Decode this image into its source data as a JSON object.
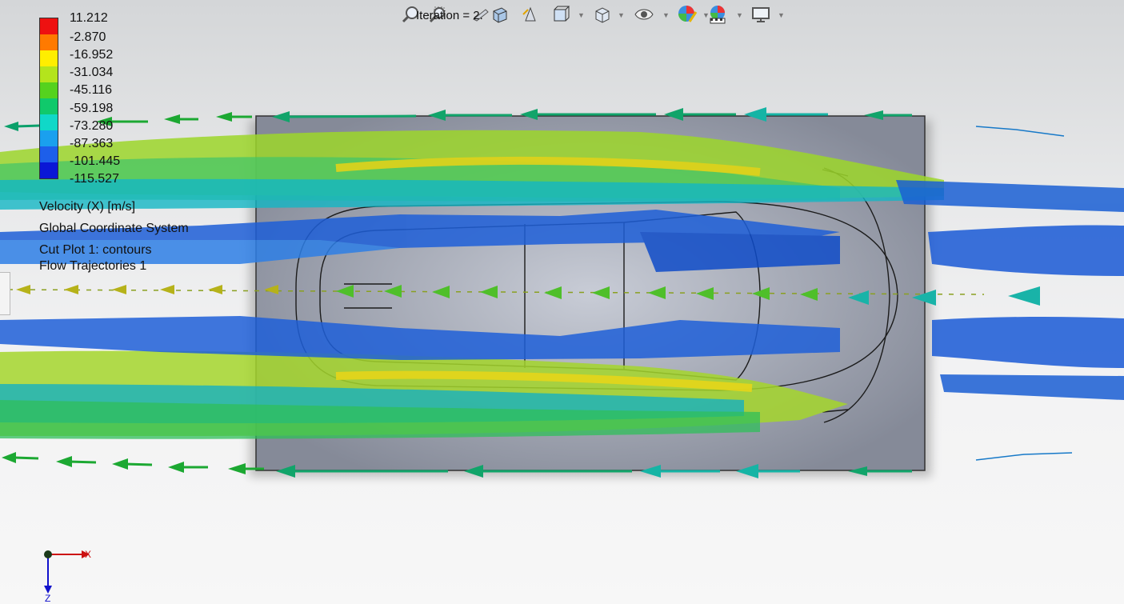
{
  "toolbar": {
    "iteration_label": "Iteration = 2.",
    "buttons": [
      {
        "name": "zoom-to-fit-icon"
      },
      {
        "name": "zoom-to-area-icon"
      },
      {
        "name": "previous-view-icon"
      },
      {
        "name": "section-view-icon"
      },
      {
        "name": "view-orientation-icon"
      },
      {
        "name": "display-style-icon"
      },
      {
        "name": "hide-show-items-icon"
      },
      {
        "name": "edit-appearance-icon"
      },
      {
        "name": "apply-scene-icon"
      },
      {
        "name": "view-settings-icon"
      }
    ]
  },
  "legend": {
    "values": [
      "11.212",
      "-2.870",
      "-16.952",
      "-31.034",
      "-45.116",
      "-59.198",
      "-73.280",
      "-87.363",
      "-101.445",
      "-115.527"
    ],
    "colors": [
      "#ee1111",
      "#ff7a00",
      "#ffee00",
      "#b4e41c",
      "#55d21e",
      "#10c96b",
      "#10d8c8",
      "#1aa0ee",
      "#1d5fea",
      "#0a17d6"
    ],
    "quantity": "Velocity (X) [m/s]",
    "coordinate_system": "Global Coordinate System",
    "cut_plot": "Cut Plot 1: contours",
    "flow_trajectories": "Flow Trajectories 1"
  },
  "triad": {
    "x_label": "X",
    "z_label": "Z"
  },
  "colors": {
    "body_gray": "#8e939f",
    "outline": "#222222"
  }
}
